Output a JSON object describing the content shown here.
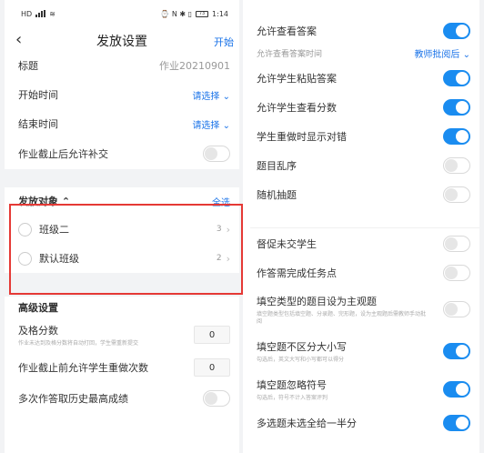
{
  "status": {
    "carrier": "HD",
    "icons_right": "⌚ N ✱ ▯",
    "battery": "73",
    "time": "1:14"
  },
  "nav": {
    "back_icon": "‹",
    "title": "发放设置",
    "action": "开始"
  },
  "form": {
    "title_label": "标题",
    "title_value": "作业20210901",
    "start_label": "开始时间",
    "start_value": "请选择",
    "end_label": "结束时间",
    "end_value": "请选择",
    "late_label": "作业截止后允许补交"
  },
  "target": {
    "header": "发放对象",
    "caret": "^",
    "select_all": "全选",
    "classes": [
      {
        "name": "班级二",
        "count": "3"
      },
      {
        "name": "默认班级",
        "count": "2"
      }
    ]
  },
  "advanced": {
    "header": "高级设置",
    "pass_label": "及格分数",
    "pass_sub": "作业未达到及格分数将自动打回，学生需重新提交",
    "pass_value": "0",
    "redo_label": "作业截止前允许学生重做次数",
    "redo_value": "0",
    "history_label": "多次作答取历史最高成绩"
  },
  "right": {
    "view_answer": "允许查看答案",
    "view_time_label": "允许查看答案时间",
    "view_time_value": "教师批阅后",
    "paste": "允许学生粘贴答案",
    "view_score": "允许学生查看分数",
    "show_correct": "学生重做时显示对错",
    "shuffle": "题目乱序",
    "random": "随机抽题",
    "urge": "督促未交学生",
    "task_points": "作答需完成任务点",
    "fill_subjective": "填空类型的题目设为主观题",
    "fill_subjective_sub": "填空题类型包括填空题、分录题、完形题，设为主观题后需教师手动批阅",
    "case_ins": "填空题不区分大小写",
    "case_ins_sub": "勾选后，英文大写和小写都可以得分",
    "ignore_sym": "填空题忽略符号",
    "ignore_sym_sub": "勾选后，符号不计入答案评判",
    "multi_half": "多选题未选全给一半分"
  },
  "colors": {
    "accent": "#1a8cf0",
    "highlight": "#e53935"
  }
}
